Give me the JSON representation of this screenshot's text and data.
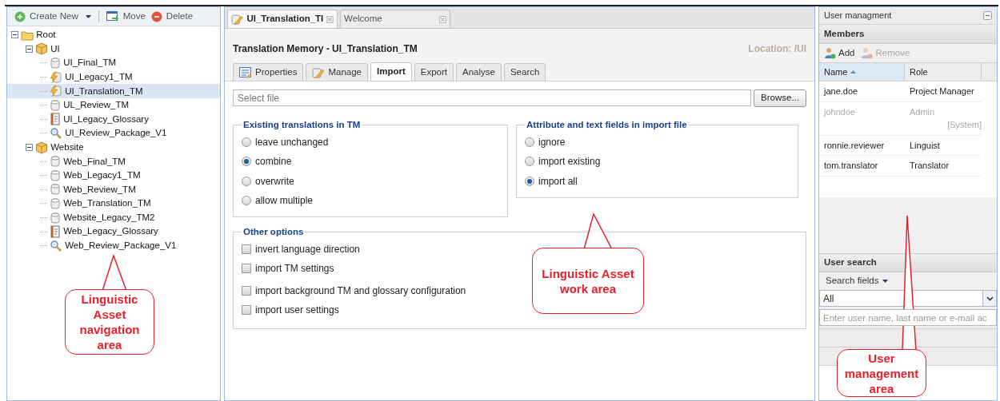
{
  "nav_toolbar": [
    {
      "label": "Create New",
      "kind": "create"
    },
    {
      "label": "Move",
      "kind": "move"
    },
    {
      "label": "Delete",
      "kind": "delete"
    }
  ],
  "tree": [
    {
      "label": "Root",
      "kind": "folder",
      "expanded": true,
      "selected": false,
      "children": [
        {
          "label": "UI",
          "kind": "package",
          "expanded": true,
          "selected": false,
          "children": [
            {
              "label": "UI_Final_TM",
              "kind": "tm",
              "selected": false
            },
            {
              "label": "UI_Legacy1_TM",
              "kind": "tm-active",
              "selected": false
            },
            {
              "label": "UI_Translation_TM",
              "kind": "tm-active",
              "selected": true
            },
            {
              "label": "UL_Review_TM",
              "kind": "tm",
              "selected": false
            },
            {
              "label": "UI_Legacy_Glossary",
              "kind": "glossary",
              "selected": false
            },
            {
              "label": "UI_Review_Package_V1",
              "kind": "review",
              "selected": false
            }
          ]
        },
        {
          "label": "Website",
          "kind": "package",
          "expanded": true,
          "selected": false,
          "children": [
            {
              "label": "Web_Final_TM",
              "kind": "tm",
              "selected": false
            },
            {
              "label": "Web_Legacy1_TM",
              "kind": "tm",
              "selected": false
            },
            {
              "label": "Web_Review_TM",
              "kind": "tm",
              "selected": false
            },
            {
              "label": "Web_Translation_TM",
              "kind": "tm",
              "selected": false
            },
            {
              "label": "Website_Legacy_TM2",
              "kind": "tm",
              "selected": false
            },
            {
              "label": "Web_Legacy_Glossary",
              "kind": "glossary",
              "selected": false
            },
            {
              "label": "Web_Review_Package_V1",
              "kind": "review",
              "selected": false
            }
          ]
        }
      ]
    }
  ],
  "doc_tabs": [
    {
      "label": "UI_Translation_TI",
      "selected": true
    },
    {
      "label": "Welcome",
      "selected": false
    }
  ],
  "heading": "Translation Memory - UI_Translation_TM",
  "location": "Location: /UI",
  "tabs": [
    {
      "label": "Properties",
      "kind": "properties",
      "selected": false
    },
    {
      "label": "Manage",
      "kind": "pencil",
      "selected": false
    },
    {
      "label": "Import",
      "selected": true
    },
    {
      "label": "Export",
      "selected": false
    },
    {
      "label": "Analyse",
      "selected": false
    },
    {
      "label": "Search",
      "selected": false
    }
  ],
  "file_field": {
    "placeholder": "Select file"
  },
  "browse_button": "Browse...",
  "groups": [
    {
      "title": "Existing translations in TM",
      "options": [
        {
          "label": "leave unchanged",
          "selected": false
        },
        {
          "label": "combine",
          "selected": true
        },
        {
          "label": "overwrite",
          "selected": false
        },
        {
          "label": "allow multiple",
          "selected": false
        }
      ]
    },
    {
      "title": "Attribute and text fields in import file",
      "options": [
        {
          "label": "ignore",
          "selected": false
        },
        {
          "label": "import existing",
          "selected": false
        },
        {
          "label": "import all",
          "selected": true
        }
      ]
    }
  ],
  "other_options": {
    "title": "Other options",
    "items": [
      {
        "label": "invert language direction",
        "checked": false
      },
      {
        "label": "import TM settings",
        "checked": false
      },
      {
        "label": "import background TM and glossary configuration",
        "checked": false
      },
      {
        "label": "import user settings",
        "checked": false
      }
    ]
  },
  "user_panel": {
    "title": "User managment",
    "members_title": "Members",
    "toolbar": [
      {
        "label": "Add",
        "disabled": false
      },
      {
        "label": "Remove",
        "disabled": true
      }
    ],
    "columns": [
      {
        "label": "Name",
        "sorted": true
      },
      {
        "label": "Role",
        "sorted": false
      }
    ],
    "rows": [
      {
        "name": "jane.doe",
        "role": "Project Manager",
        "disabled": false
      },
      {
        "name": "johndoe",
        "role": "Admin",
        "note": "[System]",
        "disabled": true
      },
      {
        "name": "ronnie.reviewer",
        "role": "Linguist",
        "disabled": false
      },
      {
        "name": "tom.translator",
        "role": "Translator",
        "disabled": false
      }
    ],
    "search_title": "User search",
    "search_fields": "Search fields",
    "filter_value": "All",
    "search_placeholder": "Enter user name, last name or e-mail ac"
  },
  "callouts": [
    {
      "text": "Linguistic Asset navigation area"
    },
    {
      "text": "Linguistic Asset work area"
    },
    {
      "text": "User management area"
    }
  ]
}
